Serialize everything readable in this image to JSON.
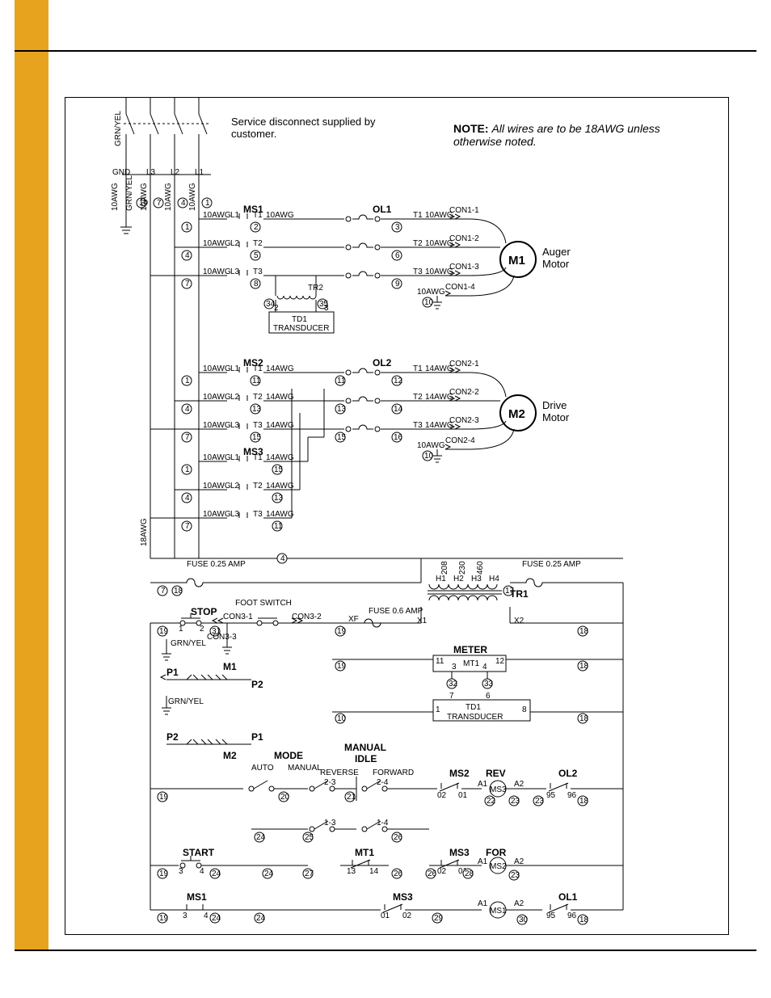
{
  "page": {
    "service_note": "Service disconnect supplied by customer.",
    "note_prefix": "NOTE:",
    "note_body": "All wires are to be 18AWG unless otherwise noted."
  },
  "gnd": "GND",
  "lines": [
    "L3",
    "L2",
    "L1"
  ],
  "wire_gauges": {
    "tenAWG": "10AWG",
    "fourteenAWG": "14AWG",
    "eighteenAWG": "18AWG",
    "grn_yel": "GRN/YEL"
  },
  "starters": {
    "ms1": {
      "name": "MS1",
      "rows": [
        "L1",
        "L2",
        "L3"
      ],
      "t": [
        "T1",
        "T2",
        "T3"
      ]
    },
    "ms2": {
      "name": "MS2",
      "rows": [
        "L1",
        "L2",
        "L3"
      ],
      "t": [
        "T1",
        "T2",
        "T3"
      ]
    },
    "ms3": {
      "name": "MS3",
      "rows": [
        "L1",
        "L2",
        "L3"
      ],
      "t": [
        "T1",
        "T2",
        "T3"
      ]
    }
  },
  "overloads": {
    "ol1": "OL1",
    "ol2": "OL2"
  },
  "transducer": {
    "name": "TD1",
    "sub": "TRANSDUCER",
    "tr2": "TR2"
  },
  "connectors": {
    "con1": [
      "CON1-1",
      "CON1-2",
      "CON1-3",
      "CON1-4"
    ],
    "con2": [
      "CON2-1",
      "CON2-2",
      "CON2-3",
      "CON2-4"
    ],
    "con3": [
      "CON3-1",
      "CON3-2",
      "CON3-3"
    ]
  },
  "motors": {
    "m1": {
      "tag": "M1",
      "label": "Auger Motor"
    },
    "m2": {
      "tag": "M2",
      "label": "Drive Motor"
    }
  },
  "fuses": {
    "quarter": "FUSE 0.25 AMP",
    "six_tenth": "FUSE 0.6 AMP"
  },
  "transformer": {
    "name": "TR1",
    "pri": [
      "H1",
      "H2",
      "H3",
      "H4"
    ],
    "pri_v": [
      "208",
      "230",
      "460"
    ],
    "sec": [
      "X1",
      "X2",
      "XF"
    ]
  },
  "meter": {
    "name": "METER",
    "mt1": "MT1",
    "pins": [
      "11",
      "12",
      "3",
      "4",
      "7",
      "6",
      "1",
      "8",
      "13",
      "14"
    ]
  },
  "controls": {
    "stop": "STOP",
    "foot": "FOOT SWITCH",
    "start": "START",
    "mode": "MODE",
    "auto": "AUTO",
    "manual": "MANUAL",
    "idle": "IDLE",
    "manual_idle": "MANUAL",
    "reverse": "REVERSE",
    "forward": "FORWARD",
    "rev": "REV",
    "for": "FOR",
    "p1": "P1",
    "p2": "P2",
    "m1": "M1",
    "m2": "M2",
    "pos": {
      "p23": "2-3",
      "p24": "2-4",
      "p13": "1-3",
      "p14": "1-4"
    },
    "a": {
      "a1": "A1",
      "a2": "A2"
    },
    "nc": {
      "n01": "01",
      "n02": "02"
    },
    "nc2": {
      "n95": "95",
      "n96": "96"
    },
    "ns": {
      "n3": "3",
      "n4": "4",
      "n1": "1",
      "n2": "2"
    }
  },
  "wire_numbers": {
    "list": [
      "1",
      "2",
      "3",
      "4",
      "5",
      "6",
      "7",
      "8",
      "9",
      "10",
      "11",
      "12",
      "13",
      "14",
      "15",
      "16",
      "17",
      "18",
      "19",
      "20",
      "21",
      "22",
      "23",
      "24",
      "25",
      "26",
      "27",
      "28",
      "29",
      "30",
      "31",
      "32",
      "33",
      "34",
      "35"
    ]
  }
}
